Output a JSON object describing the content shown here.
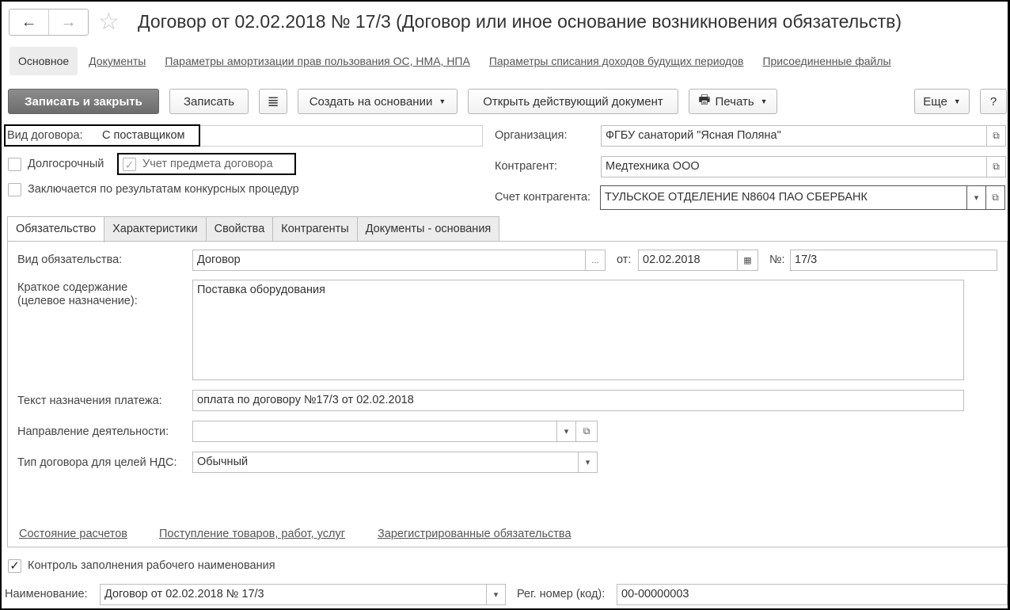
{
  "window": {
    "title": "Договор от 02.02.2018 № 17/3 (Договор или иное основание возникновения обязательств)",
    "back_icon": "←",
    "forward_icon": "→",
    "star_icon": "☆"
  },
  "top_tabs": {
    "active": "Основное",
    "links": [
      "Документы",
      "Параметры амортизации прав пользования ОС, НМА, НПА",
      "Параметры списания доходов будущих периодов",
      "Присоединенные файлы"
    ]
  },
  "toolbar": {
    "save_close": "Записать и закрыть",
    "save": "Записать",
    "list_icon": "≣",
    "create_based": "Создать на основании",
    "open_doc": "Открыть действующий документ",
    "print": "Печать",
    "print_icon": "🖶",
    "more": "Еще",
    "help": "?"
  },
  "left_fields": {
    "contract_type_label": "Вид договора:",
    "contract_type_value": "С поставщиком",
    "long_term_label": "Долгосрочный",
    "subject_label": "Учет предмета договора",
    "tender_label": "Заключается по результатам конкурсных процедур"
  },
  "right_fields": {
    "org_label": "Организация:",
    "org_value": "ФГБУ санаторий \"Ясная Поляна\"",
    "counterparty_label": "Контрагент:",
    "counterparty_value": "Медтехника ООО",
    "account_label": "Счет контрагента:",
    "account_value": "ТУЛЬСКОЕ ОТДЕЛЕНИЕ N8604 ПАО СБЕРБАНК"
  },
  "inner_tabs": [
    "Обязательство",
    "Характеристики",
    "Свойства",
    "Контрагенты",
    "Документы - основания"
  ],
  "obligation": {
    "type_label": "Вид обязательства:",
    "type_value": "Договор",
    "ellipsis": "...",
    "from_label": "от:",
    "date_value": "02.02.2018",
    "number_label": "№:",
    "number_value": "17/3",
    "summary_label_1": "Краткое содержание",
    "summary_label_2": "(целевое назначение):",
    "summary_value": "Поставка оборудования",
    "payment_text_label": "Текст назначения платежа:",
    "payment_text_value": "оплата по договору №17/3 от 02.02.2018",
    "direction_label": "Направление деятельности:",
    "direction_value": "",
    "vat_type_label": "Тип договора для целей НДС:",
    "vat_type_value": "Обычный"
  },
  "bottom_links": [
    "Состояние расчетов",
    "Поступление товаров, работ, услуг",
    "Зарегистрированные обязательства"
  ],
  "footer": {
    "control_label": "Контроль заполнения рабочего наименования",
    "name_label": "Наименование:",
    "name_value": "Договор от 02.02.2018 № 17/3",
    "reg_label": "Рег. номер (код):",
    "reg_value": "00-00000003"
  },
  "colors": {
    "primary_button": "#7a7a7a",
    "highlight_border": "#000000"
  }
}
